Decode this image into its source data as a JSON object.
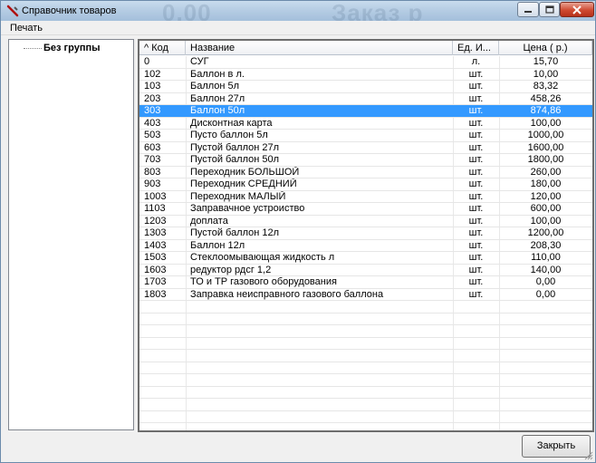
{
  "window": {
    "title": "Справочник товаров",
    "background_ghost": [
      "0,00",
      "Заказ  р"
    ]
  },
  "menu": {
    "items": [
      {
        "label": "Печать"
      }
    ]
  },
  "tree": {
    "root_label": "Без группы"
  },
  "table": {
    "columns": [
      "^ Код",
      "Название",
      "Ед. И...",
      "Цена ( р.)"
    ],
    "rows": [
      {
        "code": "0",
        "name": "СУГ",
        "unit": "л.",
        "price": "15,70"
      },
      {
        "code": "102",
        "name": "Баллон в л.",
        "unit": "шт.",
        "price": "10,00"
      },
      {
        "code": "103",
        "name": "Баллон 5л",
        "unit": "шт.",
        "price": "83,32"
      },
      {
        "code": "203",
        "name": "Баллон 27л",
        "unit": "шт.",
        "price": "458,26"
      },
      {
        "code": "303",
        "name": "Баллон 50л",
        "unit": "шт.",
        "price": "874,86"
      },
      {
        "code": "403",
        "name": "Дисконтная карта",
        "unit": "шт.",
        "price": "100,00"
      },
      {
        "code": "503",
        "name": "Пусто баллон 5л",
        "unit": "шт.",
        "price": "1000,00"
      },
      {
        "code": "603",
        "name": "Пустой баллон 27л",
        "unit": "шт.",
        "price": "1600,00"
      },
      {
        "code": "703",
        "name": "Пустой баллон 50л",
        "unit": "шт.",
        "price": "1800,00"
      },
      {
        "code": "803",
        "name": "Переходник БОЛЬШОЙ",
        "unit": "шт.",
        "price": "260,00"
      },
      {
        "code": "903",
        "name": "Переходник СРЕДНИЙ",
        "unit": "шт.",
        "price": "180,00"
      },
      {
        "code": "1003",
        "name": "Переходник МАЛЫЙ",
        "unit": "шт.",
        "price": "120,00"
      },
      {
        "code": "1103",
        "name": "Заправачное устроиство",
        "unit": "шт.",
        "price": "600,00"
      },
      {
        "code": "1203",
        "name": "доплата",
        "unit": "шт.",
        "price": "100,00"
      },
      {
        "code": "1303",
        "name": "Пустой баллон 12л",
        "unit": "шт.",
        "price": "1200,00"
      },
      {
        "code": "1403",
        "name": "Баллон 12л",
        "unit": "шт.",
        "price": "208,30"
      },
      {
        "code": "1503",
        "name": "Стеклоомывающая жидкость л",
        "unit": "шт.",
        "price": "110,00"
      },
      {
        "code": "1603",
        "name": "редуктор рдсг    1,2",
        "unit": "шт.",
        "price": "140,00"
      },
      {
        "code": "1703",
        "name": "ТО и ТР газового оборудования",
        "unit": "шт.",
        "price": "0,00"
      },
      {
        "code": "1803",
        "name": "Заправка неисправного газового баллона",
        "unit": "шт.",
        "price": "0,00"
      }
    ],
    "selected_code": "303",
    "empty_rows": 11
  },
  "footer": {
    "close_label": "Закрыть"
  },
  "colors": {
    "selection": "#3399ff",
    "close_button": "#cf4a31"
  }
}
